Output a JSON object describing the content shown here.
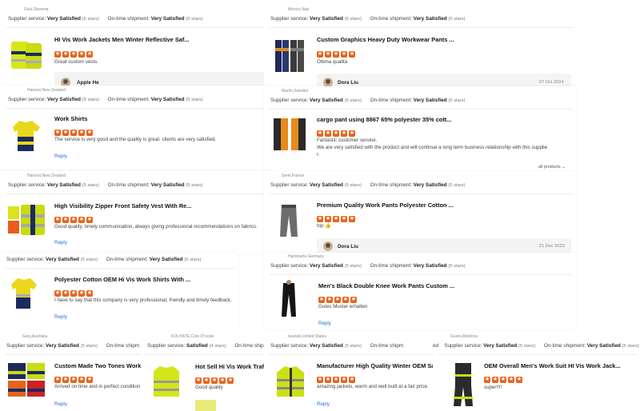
{
  "labels": {
    "supplier_service": "Supplier service:",
    "ontime": "On-time shipment:",
    "very_satisfied": "Very Satisfied",
    "satisfied": "Satisfied",
    "five_stars": "(5 stars)",
    "four_stars": "(4 stars)",
    "reply": "Reply",
    "all_products": "all products"
  },
  "cards": {
    "c1": {
      "location": "Gick,Slovenia",
      "title": "HI Vis Work Jackets Men Winter Reflective Saf...",
      "review": "Great custom vests.",
      "seller": "Apple He"
    },
    "c2": {
      "location": "Mexico,Italy",
      "title": "Custom Graphics Heavy Duty Workwear Pants ...",
      "review": "Ottima qualità",
      "seller": "Dora Liu",
      "date": "07 Oct 2024"
    },
    "c3": {
      "location": "Hanson,New Zealand",
      "title": "Work Shirts",
      "review": "The service is very good and the quality is great. clients are very satisfied."
    },
    "c4": {
      "location": "Martin,Sweden",
      "title": "cargo pant using 8867 65% polyester 35% cott...",
      "review_l1": "Fantastic customer service.",
      "review_l2": "We are very satisfied with the product and will continue a long term business relationship with this supplie",
      "review_l3": "r."
    },
    "c5": {
      "location": "Hanson,New Zealand",
      "title": "High Visibility Zipper Front Safety Vest With Re...",
      "review": "Good quality, timely communication, always giving professional recommendations on fabrics."
    },
    "c6": {
      "location": "Semi,France",
      "title": "Premium Quality Work Pants Polyester Cotton ...",
      "review": "top 👍",
      "seller": "Dora Liu",
      "date": "21 Dec 2023"
    },
    "c7": {
      "title": "Polyester Cotton OEM Hi Vis Work Shirts With ...",
      "review": "I have to say that this company is very professional, friendly and timely feedback."
    },
    "c8": {
      "location": "Hammerle,Germany",
      "title": "Men's Black Double Knee Work Pants Custom ...",
      "review": "Gutes Muster erhalten"
    },
    "c9": {
      "location": "Grey,Australia",
      "title": "Custom Made Two Tones Work Shi",
      "review": "Arrived on time and in perfect condition",
      "ontime_cut": "On-time shipm"
    },
    "c10": {
      "location": "KOUYATE,Cote D'Ivoire",
      "title": "Hot Sell Hi Vis Work Traffic I",
      "review": "Good quality",
      "ontime_cut": "On-time shipm"
    },
    "c11": {
      "location": "Iwanski,United States",
      "title": "Manufacturer High Quality Winter OEM Safety",
      "review": "amazing jackets,  warm and well built at a fair price.",
      "ontime_cut": "On-time shipm"
    },
    "c12": {
      "location": "Gores,Moldova",
      "title": "OEM Overall Men's Work Suit HI Vis Work Jack...",
      "review": "super!!!!",
      "cut_prefix": "ed"
    }
  }
}
